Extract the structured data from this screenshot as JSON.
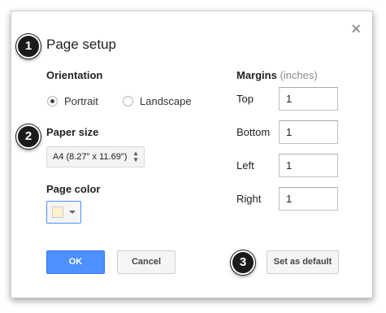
{
  "dialog": {
    "title": "Page setup",
    "close_glyph": "×"
  },
  "markers": [
    "1",
    "2",
    "3"
  ],
  "orientation": {
    "label": "Orientation",
    "options": [
      {
        "label": "Portrait",
        "checked": true
      },
      {
        "label": "Landscape",
        "checked": false
      }
    ]
  },
  "paper_size": {
    "label": "Paper size",
    "value": "A4 (8.27\" x 11.69\")",
    "arrow_up": "▲",
    "arrow_down": "▼"
  },
  "page_color": {
    "label": "Page color",
    "color": "#fff2cc"
  },
  "margins": {
    "title": "Margins",
    "unit": "(inches)",
    "fields": [
      {
        "label": "Top",
        "value": "1"
      },
      {
        "label": "Bottom",
        "value": "1"
      },
      {
        "label": "Left",
        "value": "1"
      },
      {
        "label": "Right",
        "value": "1"
      }
    ]
  },
  "buttons": {
    "ok": "OK",
    "cancel": "Cancel",
    "set_default": "Set as default"
  },
  "colors": {
    "primary": "#4d90fe",
    "marker": "#1b1b1b"
  }
}
